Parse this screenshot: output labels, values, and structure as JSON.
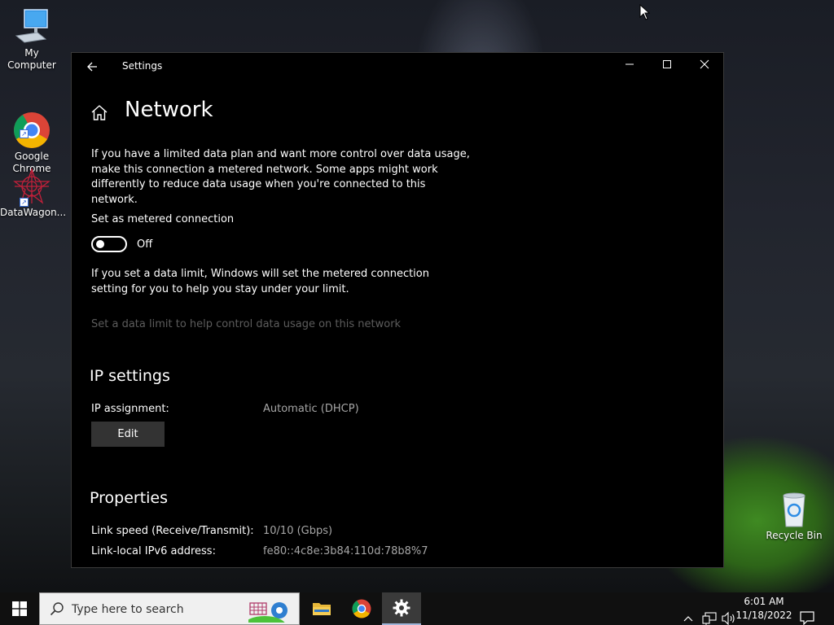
{
  "desktop": {
    "icons": [
      {
        "label": "My Computer"
      },
      {
        "label": "Google\nChrome"
      },
      {
        "label": "DataWagon..."
      },
      {
        "label": "Recycle Bin"
      }
    ]
  },
  "window": {
    "title": "Settings",
    "back_icon": "back-arrow-icon",
    "controls": {
      "minimize": "minimize-icon",
      "maximize": "maximize-icon",
      "close": "close-icon"
    }
  },
  "page": {
    "title": "Network",
    "metered_description": "If you have a limited data plan and want more control over data usage, make this connection a metered network. Some apps might work differently to reduce data usage when you're connected to this network.",
    "metered_label": "Set as metered connection",
    "metered_state": "Off",
    "data_limit_description": "If you set a data limit, Windows will set the metered connection setting for you to help you stay under your limit.",
    "data_limit_link": "Set a data limit to help control data usage on this network",
    "ip_settings": {
      "heading": "IP settings",
      "assignment_label": "IP assignment:",
      "assignment_value": "Automatic (DHCP)",
      "edit_label": "Edit"
    },
    "properties": {
      "heading": "Properties",
      "rows": [
        {
          "key": "Link speed (Receive/Transmit):",
          "value": "10/10 (Gbps)"
        },
        {
          "key": "Link-local IPv6 address:",
          "value": "fe80::4c8e:3b84:110d:78b8%7"
        }
      ]
    }
  },
  "taskbar": {
    "search_placeholder": "Type here to search",
    "time": "6:01 AM",
    "date": "11/18/2022"
  },
  "colors": {
    "window_bg": "#000000",
    "secondary_text": "#a6a6a6",
    "disabled_text": "#5c5c5c",
    "button_bg": "#333333"
  }
}
